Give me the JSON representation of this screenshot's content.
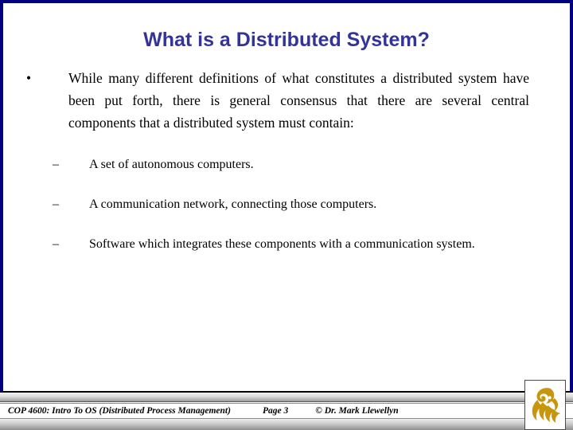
{
  "slide": {
    "title": "What is a Distributed System?",
    "accent_color": "#333399",
    "frame_color": "#000080",
    "background_color": "#ffffff",
    "body": {
      "bullets": [
        {
          "marker": "•",
          "level": 1,
          "text": "While many different definitions of what constitutes a distributed system have been put forth, there is general consensus that there are several central components that a distributed system must contain:"
        }
      ],
      "sub_bullets": [
        {
          "marker": "–",
          "level": 2,
          "text": "A set of autonomous computers."
        },
        {
          "marker": "–",
          "level": 2,
          "text": "A communication network, connecting those computers."
        },
        {
          "marker": "–",
          "level": 2,
          "text": "Software which integrates these components with a communication system."
        }
      ]
    },
    "footer": {
      "course": "COP 4600: Intro To OS  (Distributed Process Management)",
      "page": "Page 3",
      "copyright": "© Dr. Mark Llewellyn",
      "logo_name": "ucf-pegasus-logo",
      "logo_color": "#C8960C"
    }
  }
}
